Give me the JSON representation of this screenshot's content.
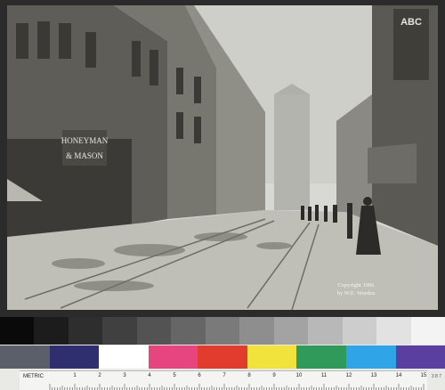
{
  "photo": {
    "caption_line1": "Copyright 1906",
    "caption_line2": "by W.E. Worden",
    "sign_left_line1": "HONEYMAN",
    "sign_left_line2": "& MASON",
    "sign_right": "ABC"
  },
  "calibration": {
    "gray_swatches": [
      "#0a0a0a",
      "#1c1c1c",
      "#2e2e2e",
      "#404040",
      "#535353",
      "#666666",
      "#7a7a7a",
      "#8e8e8e",
      "#a3a3a3",
      "#b8b8b8",
      "#cdcdcd",
      "#e2e2e2",
      "#f3f3f3"
    ],
    "color_swatches": [
      "#5a5f6a",
      "#2f2f70",
      "#ffffff",
      "#e6457d",
      "#e13c2d",
      "#f2e33c",
      "#2f9a5a",
      "#2fa4e6",
      "#5b3fa0"
    ],
    "ruler_label": "METRIC",
    "ruler_numbers": [
      "1",
      "2",
      "3",
      "4",
      "5",
      "6",
      "7",
      "8",
      "9",
      "10",
      "11",
      "12",
      "13",
      "14",
      "15"
    ],
    "corner_text": "3 8 7"
  }
}
